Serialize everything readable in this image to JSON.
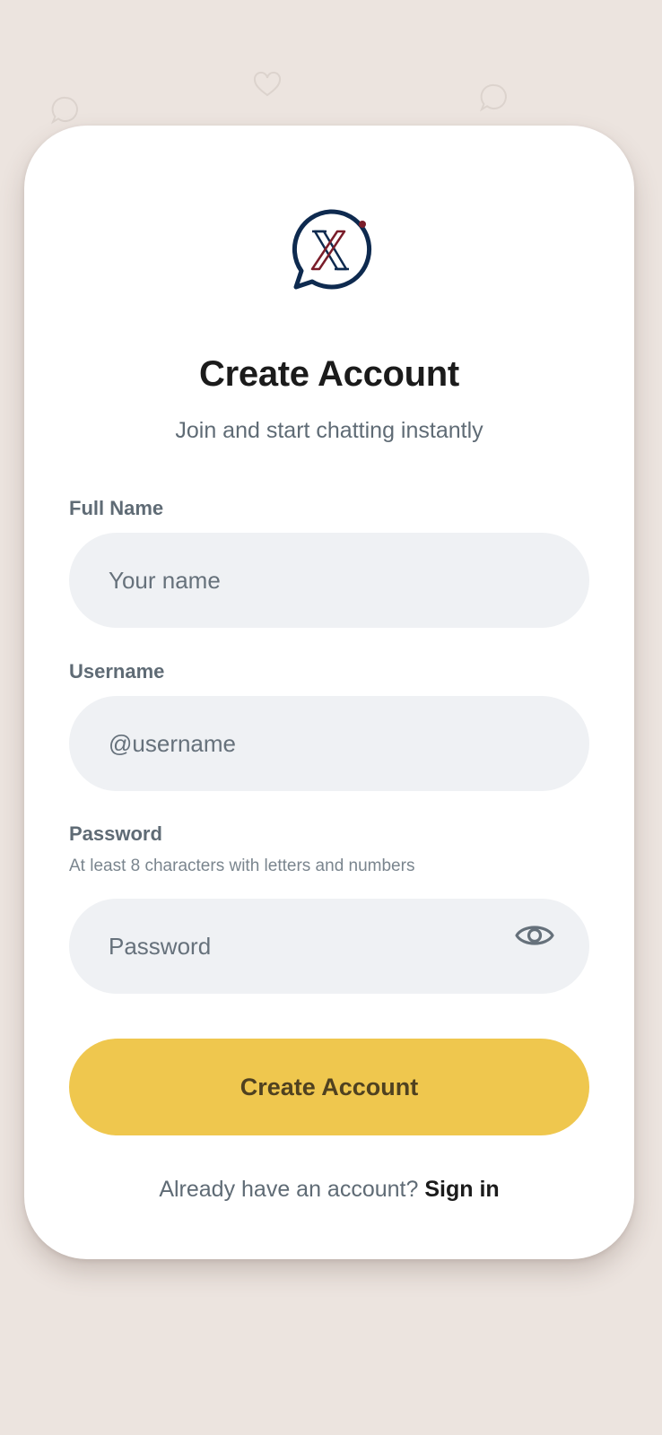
{
  "header": {
    "title": "Create Account",
    "subtitle": "Join and start chatting instantly"
  },
  "form": {
    "full_name": {
      "label": "Full Name",
      "placeholder": "Your name",
      "value": ""
    },
    "username": {
      "label": "Username",
      "placeholder": "@username",
      "value": ""
    },
    "password": {
      "label": "Password",
      "hint": "At least 8 characters with letters and numbers",
      "placeholder": "Password",
      "value": ""
    },
    "submit_label": "Create Account"
  },
  "footer": {
    "prompt": "Already have an account?",
    "link_label": "Sign in"
  },
  "icons": {
    "logo": "chat-bubble-x-logo",
    "password_toggle": "eye-icon",
    "background": [
      "chat-bubble-icon",
      "heart-icon",
      "chat-bubble-icon"
    ]
  },
  "colors": {
    "background": "#ece4df",
    "card": "#ffffff",
    "input_fill": "#eff1f4",
    "primary_button": "#efc74e",
    "primary_button_text": "#4f4120",
    "logo_navy": "#0e2a4f",
    "logo_maroon": "#7a1d2a",
    "muted_text": "#5f6b75"
  }
}
